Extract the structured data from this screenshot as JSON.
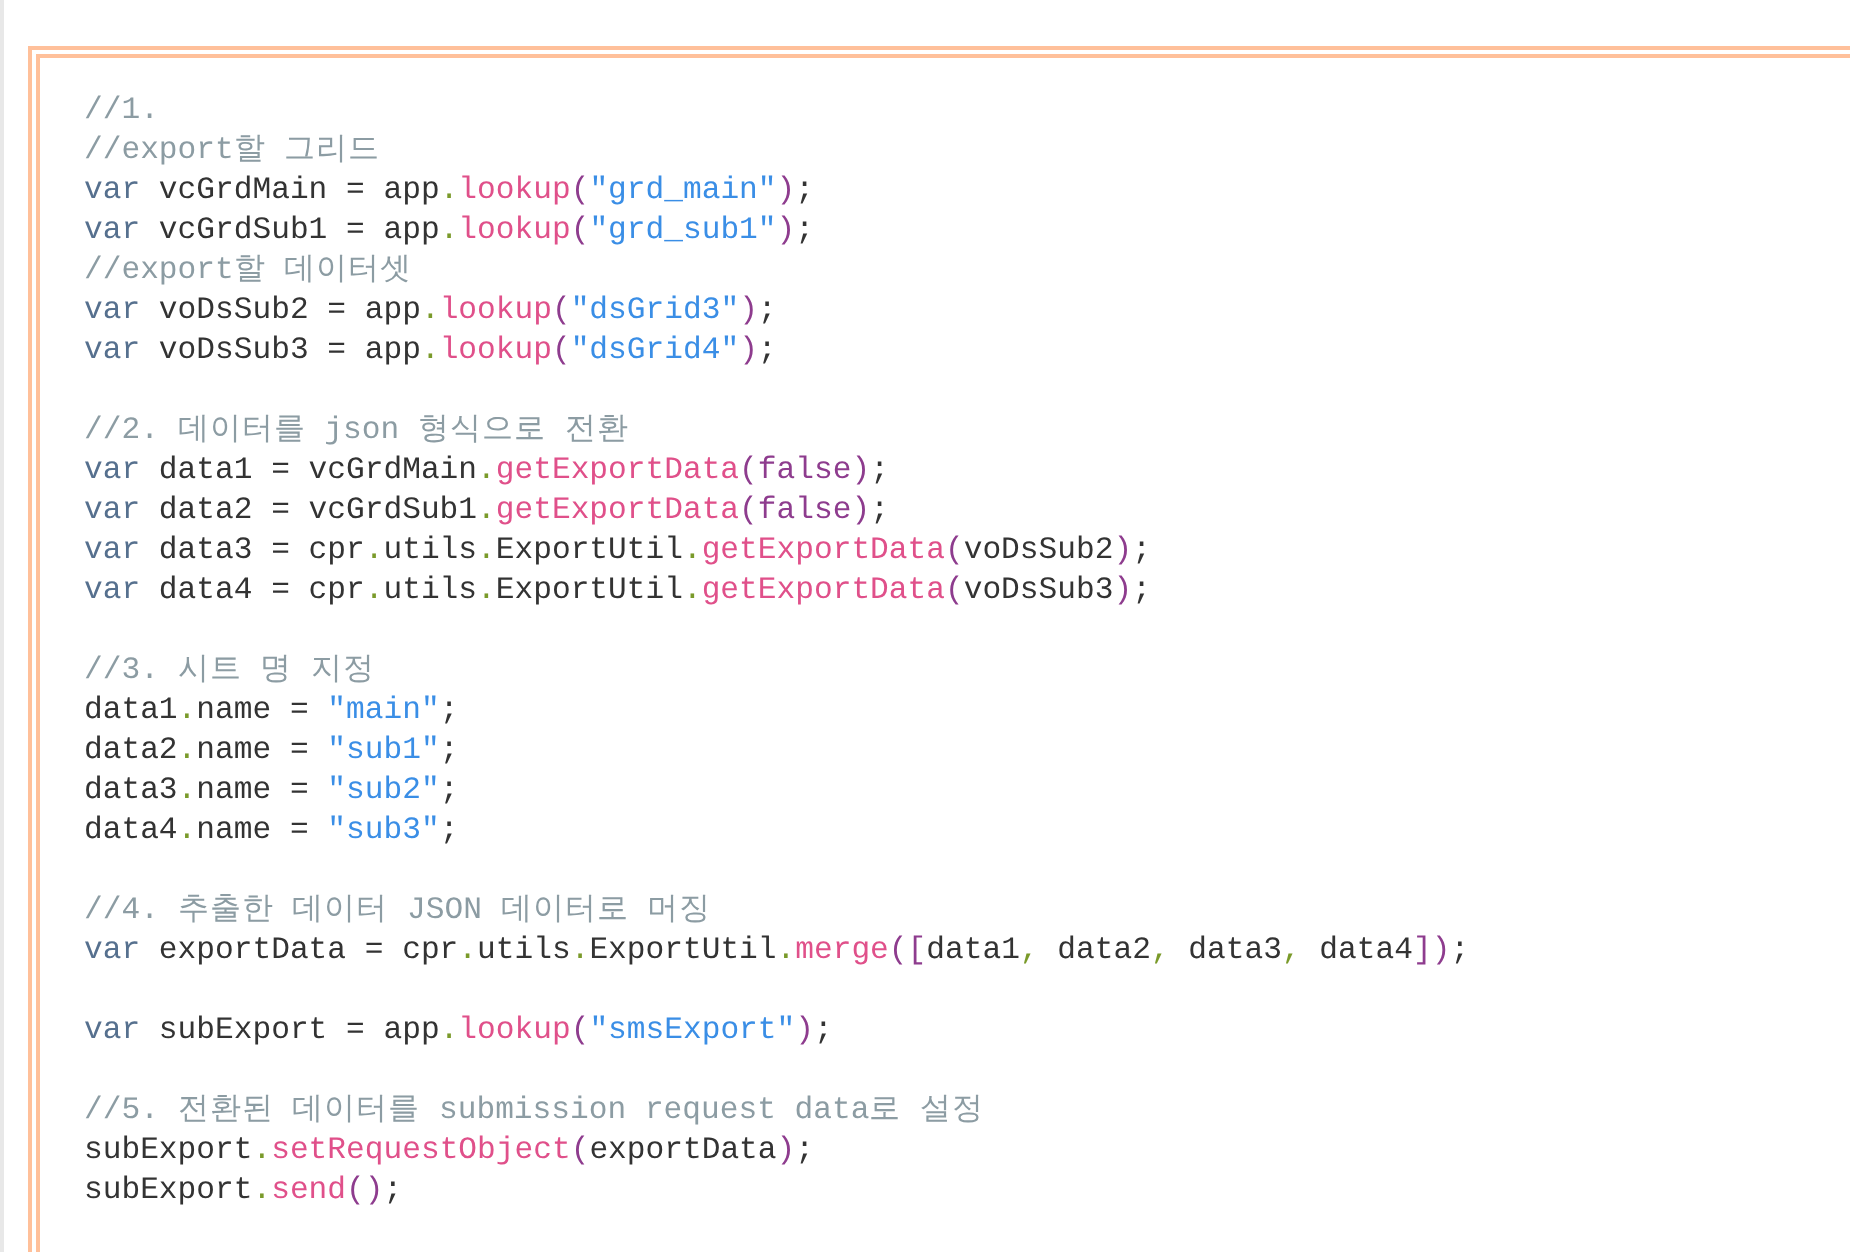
{
  "code_blocks": [
    {
      "lines": [
        {
          "tokens": [
            {
              "kind": "comment",
              "text": "//1."
            }
          ]
        },
        {
          "tokens": [
            {
              "kind": "comment",
              "text": "//export할 그리드"
            }
          ]
        },
        {
          "tokens": [
            {
              "kind": "keyword",
              "text": "var"
            },
            {
              "kind": "plain",
              "text": " vcGrdMain = app"
            },
            {
              "kind": "punct",
              "text": "."
            },
            {
              "kind": "method",
              "text": "lookup"
            },
            {
              "kind": "bracket",
              "text": "("
            },
            {
              "kind": "string",
              "text": "\"grd_main\""
            },
            {
              "kind": "bracket",
              "text": ")"
            },
            {
              "kind": "plain",
              "text": ";"
            }
          ]
        },
        {
          "tokens": [
            {
              "kind": "keyword",
              "text": "var"
            },
            {
              "kind": "plain",
              "text": " vcGrdSub1 = app"
            },
            {
              "kind": "punct",
              "text": "."
            },
            {
              "kind": "method",
              "text": "lookup"
            },
            {
              "kind": "bracket",
              "text": "("
            },
            {
              "kind": "string",
              "text": "\"grd_sub1\""
            },
            {
              "kind": "bracket",
              "text": ")"
            },
            {
              "kind": "plain",
              "text": ";"
            }
          ]
        },
        {
          "tokens": [
            {
              "kind": "comment",
              "text": "//export할 데이터셋"
            }
          ]
        },
        {
          "tokens": [
            {
              "kind": "keyword",
              "text": "var"
            },
            {
              "kind": "plain",
              "text": " voDsSub2 = app"
            },
            {
              "kind": "punct",
              "text": "."
            },
            {
              "kind": "method",
              "text": "lookup"
            },
            {
              "kind": "bracket",
              "text": "("
            },
            {
              "kind": "string",
              "text": "\"dsGrid3\""
            },
            {
              "kind": "bracket",
              "text": ")"
            },
            {
              "kind": "plain",
              "text": ";"
            }
          ]
        },
        {
          "tokens": [
            {
              "kind": "keyword",
              "text": "var"
            },
            {
              "kind": "plain",
              "text": " voDsSub3 = app"
            },
            {
              "kind": "punct",
              "text": "."
            },
            {
              "kind": "method",
              "text": "lookup"
            },
            {
              "kind": "bracket",
              "text": "("
            },
            {
              "kind": "string",
              "text": "\"dsGrid4\""
            },
            {
              "kind": "bracket",
              "text": ")"
            },
            {
              "kind": "plain",
              "text": ";"
            }
          ]
        }
      ]
    },
    {
      "lines": [
        {
          "tokens": [
            {
              "kind": "comment",
              "text": "//2. 데이터를 json 형식으로 전환"
            }
          ]
        },
        {
          "tokens": [
            {
              "kind": "keyword",
              "text": "var"
            },
            {
              "kind": "plain",
              "text": " data1 = vcGrdMain"
            },
            {
              "kind": "punct",
              "text": "."
            },
            {
              "kind": "method",
              "text": "getExportData"
            },
            {
              "kind": "bracket",
              "text": "(false)"
            },
            {
              "kind": "plain",
              "text": ";"
            }
          ]
        },
        {
          "tokens": [
            {
              "kind": "keyword",
              "text": "var"
            },
            {
              "kind": "plain",
              "text": " data2 = vcGrdSub1"
            },
            {
              "kind": "punct",
              "text": "."
            },
            {
              "kind": "method",
              "text": "getExportData"
            },
            {
              "kind": "bracket",
              "text": "(false)"
            },
            {
              "kind": "plain",
              "text": ";"
            }
          ]
        },
        {
          "tokens": [
            {
              "kind": "keyword",
              "text": "var"
            },
            {
              "kind": "plain",
              "text": " data3 = cpr"
            },
            {
              "kind": "punct",
              "text": "."
            },
            {
              "kind": "plain",
              "text": "utils"
            },
            {
              "kind": "punct",
              "text": "."
            },
            {
              "kind": "plain",
              "text": "ExportUtil"
            },
            {
              "kind": "punct",
              "text": "."
            },
            {
              "kind": "method",
              "text": "getExportData"
            },
            {
              "kind": "bracket",
              "text": "("
            },
            {
              "kind": "plain",
              "text": "voDsSub2"
            },
            {
              "kind": "bracket",
              "text": ")"
            },
            {
              "kind": "plain",
              "text": ";"
            }
          ]
        },
        {
          "tokens": [
            {
              "kind": "keyword",
              "text": "var"
            },
            {
              "kind": "plain",
              "text": " data4 = cpr"
            },
            {
              "kind": "punct",
              "text": "."
            },
            {
              "kind": "plain",
              "text": "utils"
            },
            {
              "kind": "punct",
              "text": "."
            },
            {
              "kind": "plain",
              "text": "ExportUtil"
            },
            {
              "kind": "punct",
              "text": "."
            },
            {
              "kind": "method",
              "text": "getExportData"
            },
            {
              "kind": "bracket",
              "text": "("
            },
            {
              "kind": "plain",
              "text": "voDsSub3"
            },
            {
              "kind": "bracket",
              "text": ")"
            },
            {
              "kind": "plain",
              "text": ";"
            }
          ]
        }
      ]
    },
    {
      "lines": [
        {
          "tokens": [
            {
              "kind": "comment",
              "text": "//3. 시트 명 지정"
            }
          ]
        },
        {
          "tokens": [
            {
              "kind": "plain",
              "text": "data1"
            },
            {
              "kind": "punct",
              "text": "."
            },
            {
              "kind": "plain",
              "text": "name = "
            },
            {
              "kind": "string",
              "text": "\"main\""
            },
            {
              "kind": "plain",
              "text": ";"
            }
          ]
        },
        {
          "tokens": [
            {
              "kind": "plain",
              "text": "data2"
            },
            {
              "kind": "punct",
              "text": "."
            },
            {
              "kind": "plain",
              "text": "name = "
            },
            {
              "kind": "string",
              "text": "\"sub1\""
            },
            {
              "kind": "plain",
              "text": ";"
            }
          ]
        },
        {
          "tokens": [
            {
              "kind": "plain",
              "text": "data3"
            },
            {
              "kind": "punct",
              "text": "."
            },
            {
              "kind": "plain",
              "text": "name = "
            },
            {
              "kind": "string",
              "text": "\"sub2\""
            },
            {
              "kind": "plain",
              "text": ";"
            }
          ]
        },
        {
          "tokens": [
            {
              "kind": "plain",
              "text": "data4"
            },
            {
              "kind": "punct",
              "text": "."
            },
            {
              "kind": "plain",
              "text": "name = "
            },
            {
              "kind": "string",
              "text": "\"sub3\""
            },
            {
              "kind": "plain",
              "text": ";"
            }
          ]
        }
      ]
    },
    {
      "lines": [
        {
          "tokens": [
            {
              "kind": "comment",
              "text": "//4. 추출한 데이터 JSON 데이터로 머징"
            }
          ]
        },
        {
          "tokens": [
            {
              "kind": "keyword",
              "text": "var"
            },
            {
              "kind": "plain",
              "text": " exportData = cpr"
            },
            {
              "kind": "punct",
              "text": "."
            },
            {
              "kind": "plain",
              "text": "utils"
            },
            {
              "kind": "punct",
              "text": "."
            },
            {
              "kind": "plain",
              "text": "ExportUtil"
            },
            {
              "kind": "punct",
              "text": "."
            },
            {
              "kind": "method",
              "text": "merge"
            },
            {
              "kind": "bracket",
              "text": "(["
            },
            {
              "kind": "plain",
              "text": "data1"
            },
            {
              "kind": "punct",
              "text": ","
            },
            {
              "kind": "plain",
              "text": " data2"
            },
            {
              "kind": "punct",
              "text": ","
            },
            {
              "kind": "plain",
              "text": " data3"
            },
            {
              "kind": "punct",
              "text": ","
            },
            {
              "kind": "plain",
              "text": " data4"
            },
            {
              "kind": "bracket",
              "text": "])"
            },
            {
              "kind": "plain",
              "text": ";"
            }
          ]
        }
      ]
    },
    {
      "lines": [
        {
          "tokens": [
            {
              "kind": "keyword",
              "text": "var"
            },
            {
              "kind": "plain",
              "text": " subExport = app"
            },
            {
              "kind": "punct",
              "text": "."
            },
            {
              "kind": "method",
              "text": "lookup"
            },
            {
              "kind": "bracket",
              "text": "("
            },
            {
              "kind": "string",
              "text": "\"smsExport\""
            },
            {
              "kind": "bracket",
              "text": ")"
            },
            {
              "kind": "plain",
              "text": ";"
            }
          ]
        }
      ]
    },
    {
      "lines": [
        {
          "tokens": [
            {
              "kind": "comment",
              "text": "//5. 전환된 데이터를 submission request data로 설정"
            }
          ]
        },
        {
          "tokens": [
            {
              "kind": "plain",
              "text": "subExport"
            },
            {
              "kind": "punct",
              "text": "."
            },
            {
              "kind": "method",
              "text": "setRequestObject"
            },
            {
              "kind": "bracket",
              "text": "("
            },
            {
              "kind": "plain",
              "text": "exportData"
            },
            {
              "kind": "bracket",
              "text": ")"
            },
            {
              "kind": "plain",
              "text": ";"
            }
          ]
        },
        {
          "tokens": [
            {
              "kind": "plain",
              "text": "subExport"
            },
            {
              "kind": "punct",
              "text": "."
            },
            {
              "kind": "method",
              "text": "send"
            },
            {
              "kind": "bracket",
              "text": "()"
            },
            {
              "kind": "plain",
              "text": ";"
            }
          ]
        }
      ]
    }
  ]
}
